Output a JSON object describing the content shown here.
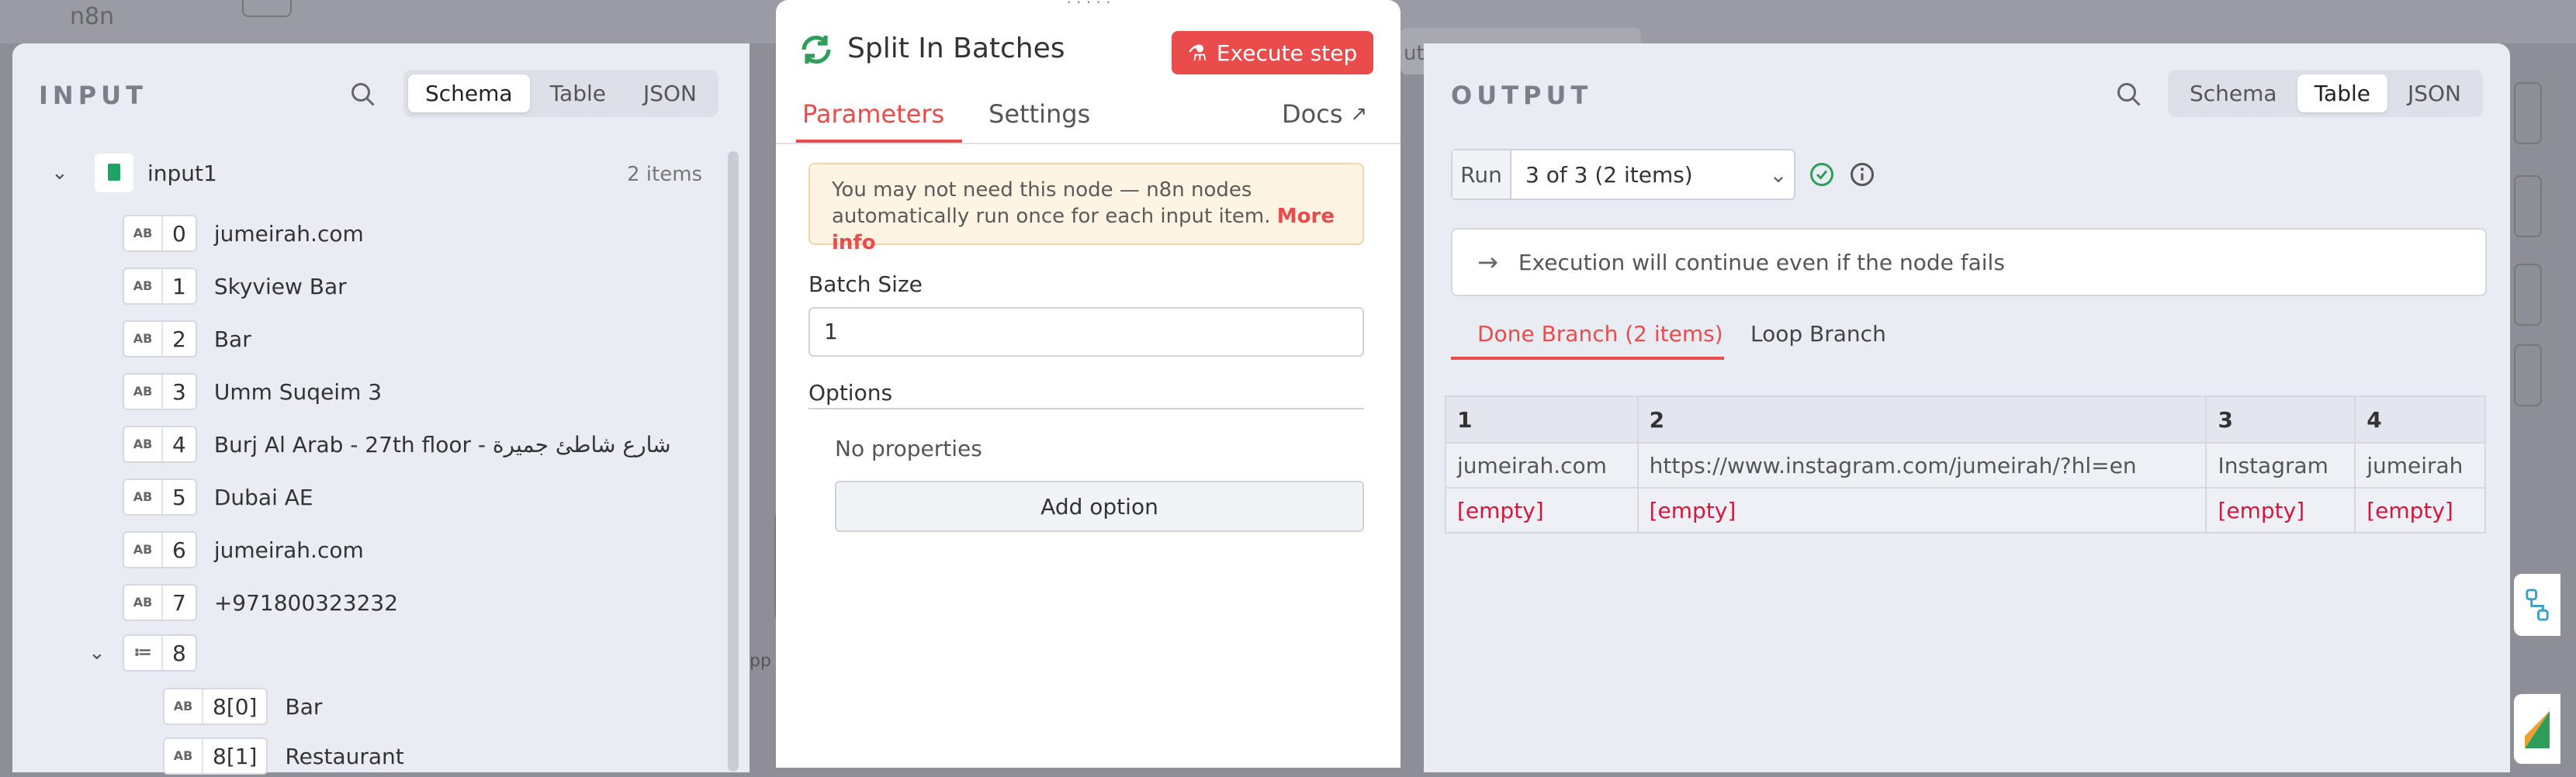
{
  "background": {
    "logo_text": "n8n",
    "peek_text": "ut",
    "peek_text2": "pp"
  },
  "input_panel": {
    "title": "INPUT",
    "view_tabs": [
      "Schema",
      "Table",
      "JSON"
    ],
    "active_tab": "Schema",
    "root": {
      "name": "input1",
      "count": "2 items"
    },
    "fields": [
      {
        "key": "0",
        "value": "jumeirah.com"
      },
      {
        "key": "1",
        "value": "Skyview Bar"
      },
      {
        "key": "2",
        "value": "Bar"
      },
      {
        "key": "3",
        "value": "Umm Suqeim 3"
      },
      {
        "key": "4",
        "value": "Burj Al Arab - 27th floor - شارع شاطئ جميرة"
      },
      {
        "key": "5",
        "value": "Dubai AE"
      },
      {
        "key": "6",
        "value": "jumeirah.com"
      },
      {
        "key": "7",
        "value": "+971800323232"
      }
    ],
    "array_field": {
      "key": "8"
    },
    "array_items": [
      {
        "key": "8[0]",
        "value": "Bar"
      },
      {
        "key": "8[1]",
        "value": "Restaurant"
      }
    ]
  },
  "node_panel": {
    "title": "Split In Batches",
    "execute_label": "Execute step",
    "tabs": [
      "Parameters",
      "Settings"
    ],
    "active_tab": "Parameters",
    "docs_label": "Docs",
    "notice_line1": "You may not need this node — n8n nodes",
    "notice_line2": "automatically run once for each input item.",
    "notice_link": "More info",
    "batch_size_label": "Batch Size",
    "batch_size_value": "1",
    "options_label": "Options",
    "no_properties": "No properties",
    "add_option_label": "Add option"
  },
  "output_panel": {
    "title": "OUTPUT",
    "view_tabs": [
      "Schema",
      "Table",
      "JSON"
    ],
    "active_tab": "Table",
    "run_label": "Run",
    "run_value": "3 of 3 (2 items)",
    "continue_message": "Execution will continue even if the node fails",
    "branch_tabs": [
      "Done Branch (2 items)",
      "Loop Branch"
    ],
    "active_branch": "Done Branch (2 items)",
    "table": {
      "headers": [
        "1",
        "2",
        "3",
        "4"
      ],
      "rows": [
        [
          "jumeirah.com",
          "https://www.instagram.com/jumeirah/?hl=en",
          "Instagram",
          "jumeirah"
        ],
        [
          "[empty]",
          "[empty]",
          "[empty]",
          "[empty]"
        ]
      ]
    }
  },
  "colors": {
    "accent": "#ea4b4b",
    "success": "#2e9e5a",
    "empty_value": "#d6163b"
  }
}
